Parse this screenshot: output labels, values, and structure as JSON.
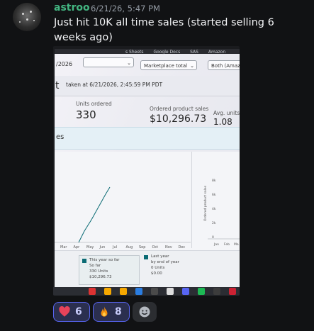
{
  "message": {
    "username": "astroo",
    "timestamp": "6/21/26, 5:47 PM",
    "text": "Just hit 10K all time sales (started selling 6 weeks ago)"
  },
  "screenshot": {
    "browser_tabs": [
      "s Sheets",
      "Google Docs",
      "SAS",
      "Amazon"
    ],
    "date_fragment": "/2026",
    "marketplace_filter": "Marketplace total",
    "fulfillment_filter": "Both (Amazon a",
    "header_fragment": "t",
    "taken_at": "taken at 6/21/2026, 2:45:59 PM PDT",
    "metrics": {
      "units_label": "Units ordered",
      "units_value": "330",
      "sales_label": "Ordered product sales",
      "sales_value": "$10,296.73",
      "avg_label": "Avg. units/ord",
      "avg_value": "1.08"
    },
    "sales_heading_fragment": "es",
    "chart_left": {
      "months": [
        "Mar",
        "Apr",
        "May",
        "Jun",
        "Jul",
        "Aug",
        "Sep",
        "Oct",
        "Nov",
        "Dec"
      ]
    },
    "chart_right": {
      "ylabel": "Ordered product sales",
      "yticks": [
        "8k",
        "6k",
        "4k",
        "2k",
        "0"
      ],
      "months": [
        "Jan",
        "Feb",
        "Ma"
      ]
    },
    "legend": {
      "this_year_title": "This year so far",
      "this_year_sub1": "So far",
      "this_year_sub2": "330 Units",
      "this_year_sub3": "$10,296.73",
      "last_year_title": "Last year",
      "last_year_sub1": "by end of year",
      "last_year_sub2": "0 Units",
      "last_year_sub3": "$0.00"
    }
  },
  "reactions": [
    {
      "emoji": "heart-emoji",
      "count": "6",
      "color": "#e8435a"
    },
    {
      "emoji": "fire-emoji",
      "count": "8",
      "color": "#f4900c"
    }
  ],
  "colors": {
    "username": "#43b581",
    "reaction_border": "#5865f2",
    "chart_line": "#0a6b74"
  }
}
